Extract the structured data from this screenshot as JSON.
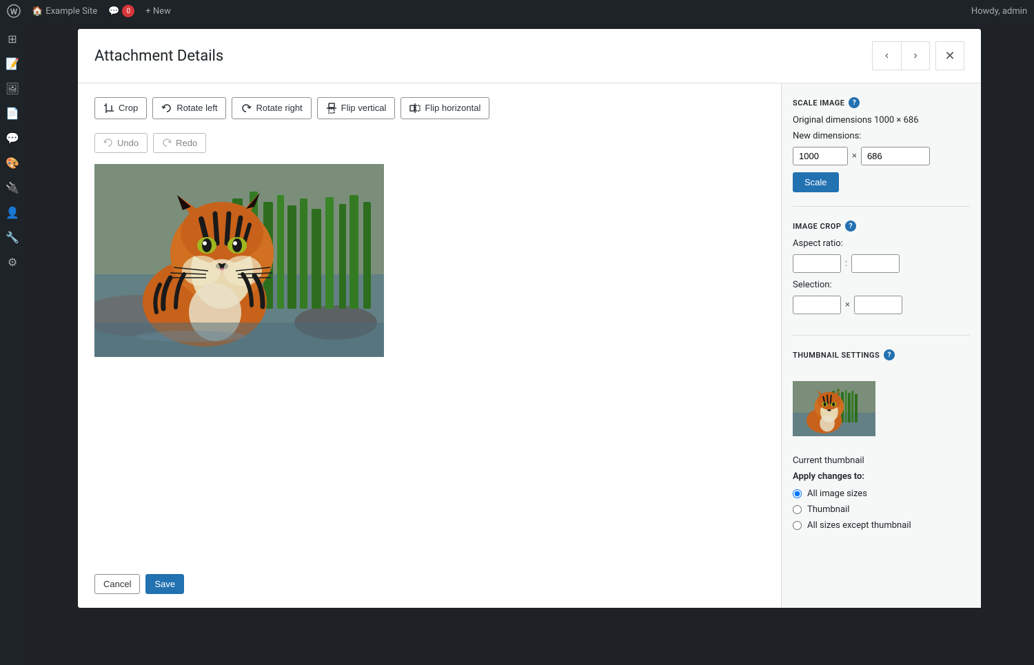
{
  "adminBar": {
    "siteName": "Example Site",
    "commentCount": "0",
    "newLabel": "+ New",
    "greeting": "Howdy, admin"
  },
  "modal": {
    "title": "Attachment Details",
    "prevLabel": "‹",
    "nextLabel": "›",
    "closeLabel": "✕"
  },
  "toolbar": {
    "cropLabel": "Crop",
    "rotateLeftLabel": "Rotate left",
    "rotateRightLabel": "Rotate right",
    "flipVerticalLabel": "Flip vertical",
    "flipHorizontalLabel": "Flip horizontal",
    "undoLabel": "Undo",
    "redoLabel": "Redo"
  },
  "actions": {
    "cancelLabel": "Cancel",
    "saveLabel": "Save"
  },
  "scaleImage": {
    "sectionTitle": "SCALE IMAGE",
    "originalDimensions": "Original dimensions 1000 × 686",
    "newDimensionsLabel": "New dimensions:",
    "widthValue": "1000",
    "heightValue": "686",
    "scaleButtonLabel": "Scale"
  },
  "imageCrop": {
    "sectionTitle": "IMAGE CROP",
    "aspectRatioLabel": "Aspect ratio:",
    "selectionLabel": "Selection:",
    "aspectW": "",
    "aspectH": "",
    "selW": "",
    "selH": ""
  },
  "thumbnailSettings": {
    "sectionTitle": "THUMBNAIL SETTINGS",
    "currentThumbnailLabel": "Current thumbnail",
    "applyChangesLabel": "Apply changes to:",
    "options": [
      {
        "id": "all-image-sizes",
        "label": "All image sizes",
        "checked": true
      },
      {
        "id": "thumbnail",
        "label": "Thumbnail",
        "checked": false
      },
      {
        "id": "all-except-thumbnail",
        "label": "All sizes except thumbnail",
        "checked": false
      }
    ]
  }
}
